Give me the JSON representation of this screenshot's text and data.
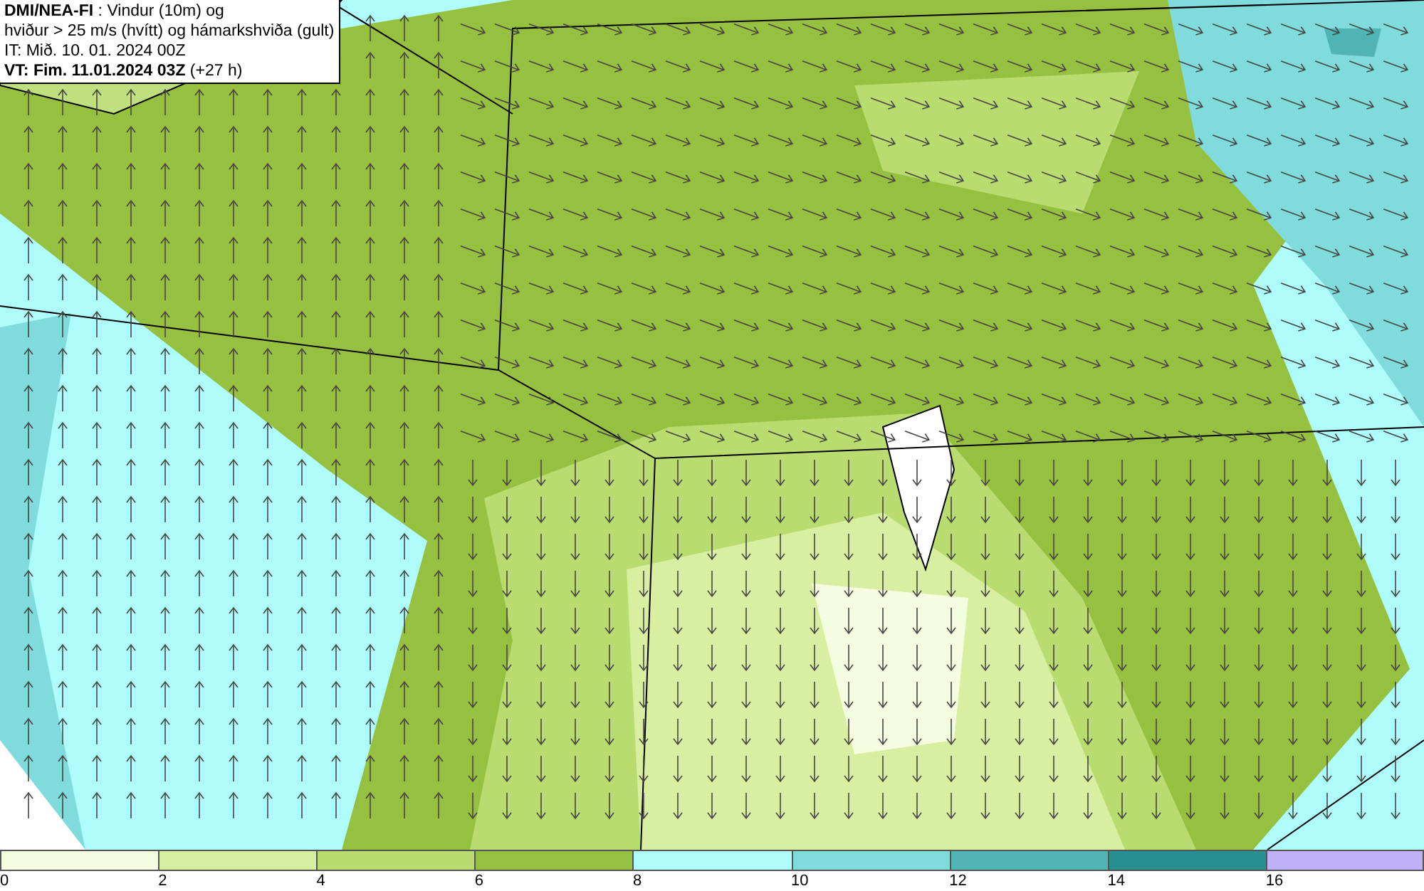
{
  "title_box": {
    "lines": [
      "**DMI/NEA-FI** : Vindur (10m) og",
      "hviður > 25 m/s (hvítt) og hámarkshviða (gult)",
      "IT: Mið. 10. 01. 2024 00Z",
      "**VT: Fim. 11.01.2024 03Z** (+27 h)"
    ]
  },
  "legend": {
    "bins": [
      {
        "label": "0",
        "color": "#f5fde0"
      },
      {
        "label": "2",
        "color": "#d8eea0"
      },
      {
        "label": "4",
        "color": "#b8dc70"
      },
      {
        "label": "6",
        "color": "#96c040"
      },
      {
        "label": "8",
        "color": "#aefcfc"
      },
      {
        "label": "10",
        "color": "#80dcdc"
      },
      {
        "label": "12",
        "color": "#50b4b4"
      },
      {
        "label": "14",
        "color": "#289090"
      },
      {
        "label": "16",
        "color": "#c0b0f8"
      }
    ]
  }
}
